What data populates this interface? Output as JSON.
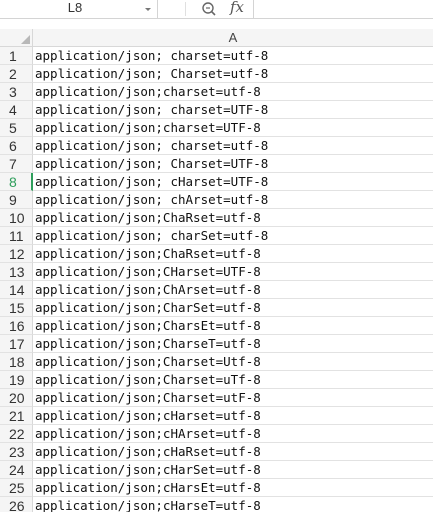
{
  "formula_bar": {
    "name_box": "L8",
    "fx_label": "fx",
    "formula_value": ""
  },
  "sheet": {
    "columns": [
      "A"
    ],
    "active_row": "8",
    "rows": [
      {
        "num": "1",
        "value": "application/json; charset=utf-8"
      },
      {
        "num": "2",
        "value": "application/json; Charset=utf-8"
      },
      {
        "num": "3",
        "value": "application/json;charset=utf-8"
      },
      {
        "num": "4",
        "value": "application/json; charset=UTF-8"
      },
      {
        "num": "5",
        "value": "application/json;charset=UTF-8"
      },
      {
        "num": "6",
        "value": "application/json; charset=utf-8"
      },
      {
        "num": "7",
        "value": "application/json; Charset=UTF-8"
      },
      {
        "num": "8",
        "value": "application/json; cHarset=UTF-8"
      },
      {
        "num": "9",
        "value": "application/json; chArset=utf-8"
      },
      {
        "num": "10",
        "value": "application/json;ChaRset=utf-8"
      },
      {
        "num": "11",
        "value": "application/json; charSet=utf-8"
      },
      {
        "num": "12",
        "value": "application/json;ChaRset=utf-8"
      },
      {
        "num": "13",
        "value": "application/json;CHarset=UTF-8"
      },
      {
        "num": "14",
        "value": "application/json;ChArset=utf-8"
      },
      {
        "num": "15",
        "value": "application/json;CharSet=utf-8"
      },
      {
        "num": "16",
        "value": "application/json;CharsEt=utf-8"
      },
      {
        "num": "17",
        "value": "application/json;CharseT=utf-8"
      },
      {
        "num": "18",
        "value": "application/json;Charset=Utf-8"
      },
      {
        "num": "19",
        "value": "application/json;Charset=uTf-8"
      },
      {
        "num": "20",
        "value": "application/json;Charset=utF-8"
      },
      {
        "num": "21",
        "value": "application/json;cHarset=utf-8"
      },
      {
        "num": "22",
        "value": "application/json;cHArset=utf-8"
      },
      {
        "num": "23",
        "value": "application/json;cHaRset=utf-8"
      },
      {
        "num": "24",
        "value": "application/json;cHarSet=utf-8"
      },
      {
        "num": "25",
        "value": "application/json;cHarsEt=utf-8"
      },
      {
        "num": "26",
        "value": "application/json;cHarseT=utf-8"
      }
    ]
  }
}
